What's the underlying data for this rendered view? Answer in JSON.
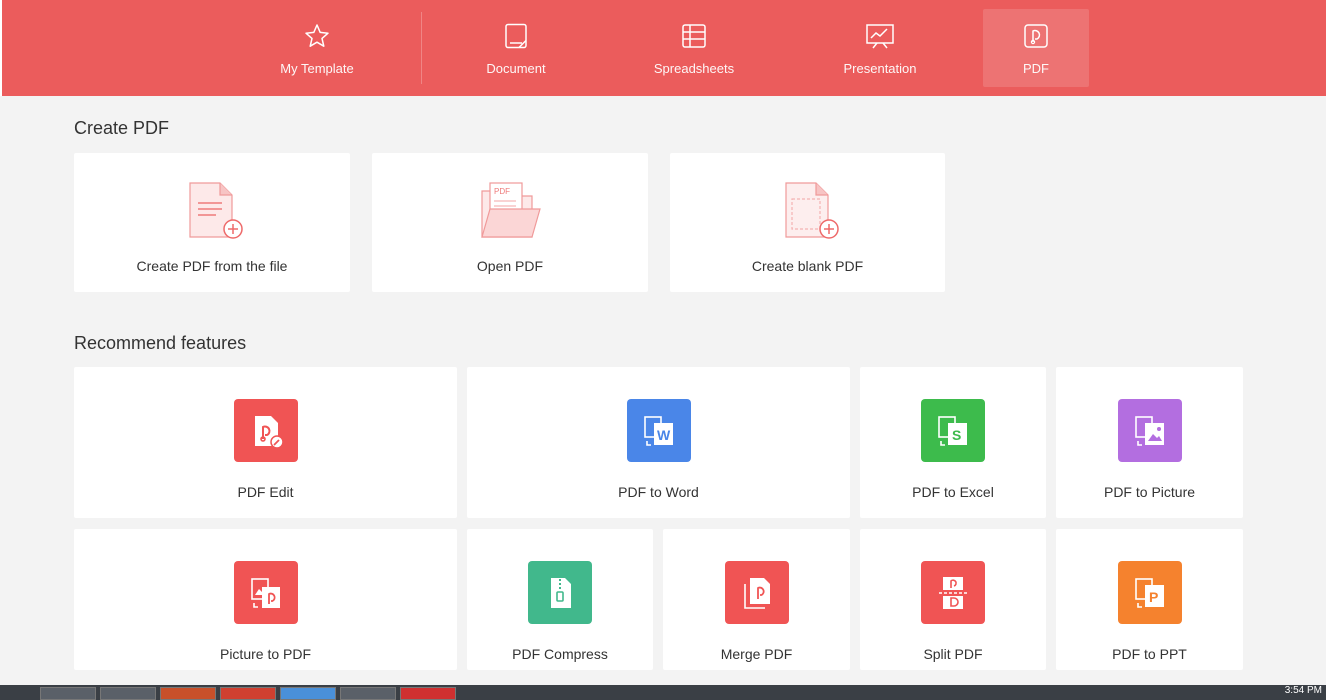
{
  "tabs": [
    {
      "label": "My Template",
      "icon": "star-icon"
    },
    {
      "label": "Document",
      "icon": "document-icon"
    },
    {
      "label": "Spreadsheets",
      "icon": "spreadsheet-icon"
    },
    {
      "label": "Presentation",
      "icon": "presentation-icon"
    },
    {
      "label": "PDF",
      "icon": "pdf-icon",
      "active": true
    }
  ],
  "create_section": {
    "title": "Create PDF",
    "cards": [
      {
        "label": "Create PDF from the file",
        "icon": "file-add-icon"
      },
      {
        "label": "Open PDF",
        "icon": "open-folder-icon"
      },
      {
        "label": "Create blank PDF",
        "icon": "blank-page-add-icon"
      }
    ]
  },
  "recommend_section": {
    "title": "Recommend features",
    "features": [
      {
        "label": "PDF Edit",
        "icon": "pdf-edit-icon",
        "color": "#f05454"
      },
      {
        "label": "PDF to Word",
        "icon": "pdf-to-word-icon",
        "color": "#4a86e8"
      },
      {
        "label": "PDF to Excel",
        "icon": "pdf-to-excel-icon",
        "color": "#3dbb4c"
      },
      {
        "label": "PDF to Picture",
        "icon": "pdf-to-picture-icon",
        "color": "#b36ee0"
      },
      {
        "label": "Picture to PDF",
        "icon": "picture-to-pdf-icon",
        "color": "#f05454"
      },
      {
        "label": "PDF Compress",
        "icon": "pdf-compress-icon",
        "color": "#41b88c"
      },
      {
        "label": "Merge PDF",
        "icon": "merge-pdf-icon",
        "color": "#f05454"
      },
      {
        "label": "Split PDF",
        "icon": "split-pdf-icon",
        "color": "#f05454"
      },
      {
        "label": "PDF to PPT",
        "icon": "pdf-to-ppt-icon",
        "color": "#f5822e"
      }
    ]
  },
  "taskbar": {
    "clock": "3:54 PM"
  },
  "colors": {
    "accent": "#eb5c5c",
    "background": "#f3f3f3"
  }
}
